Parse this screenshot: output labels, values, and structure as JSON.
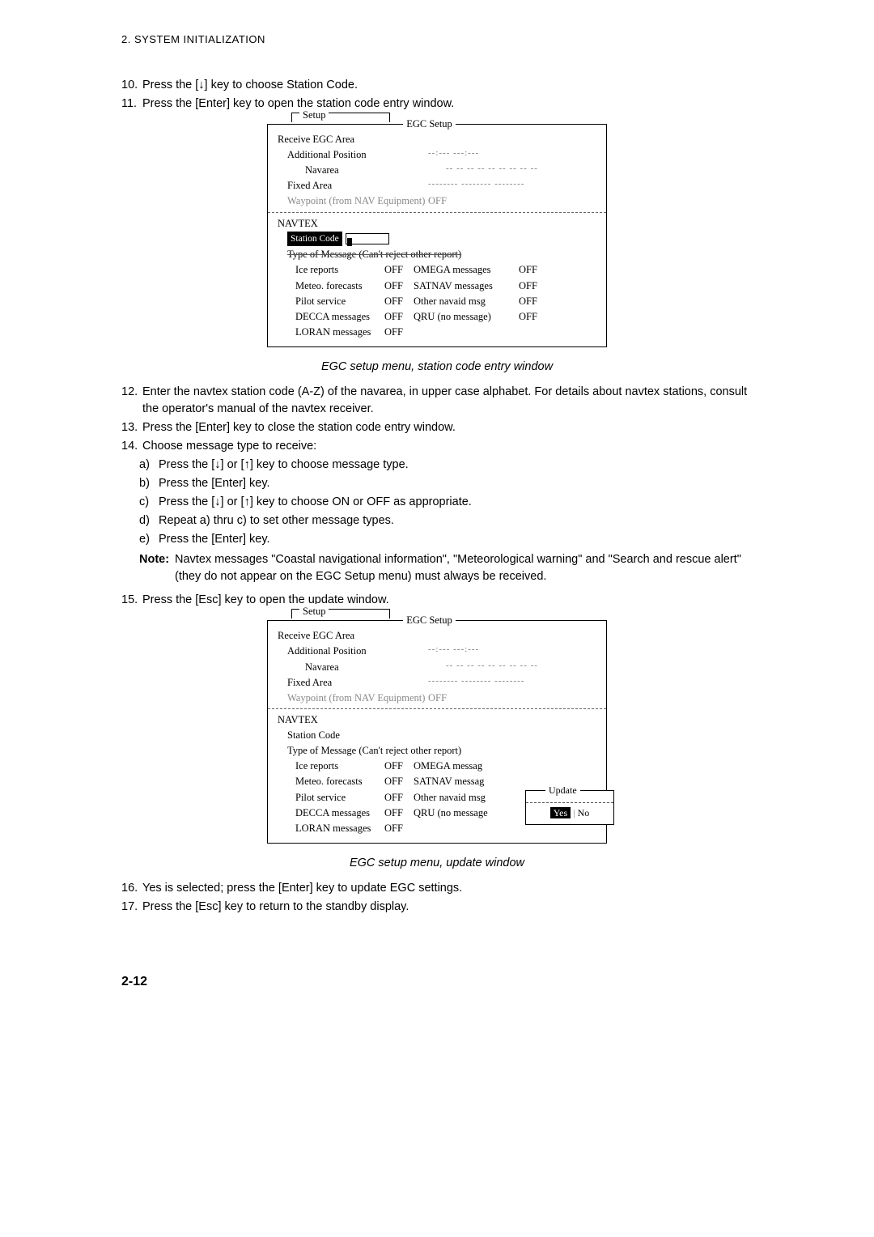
{
  "header": "2. SYSTEM INITIALIZATION",
  "steps": {
    "s10": "Press the [↓] key to choose Station Code.",
    "s11": "Press the [Enter] key to open the station code entry window.",
    "s12": "Enter the navtex station code (A-Z) of the navarea, in upper case alphabet. For details about navtex stations, consult the operator's manual of the navtex receiver.",
    "s13": "Press the [Enter] key to close the station code entry window.",
    "s14": "Choose message type to receive:",
    "s14a": "Press the [↓] or [↑] key to choose message type.",
    "s14b": "Press the [Enter] key.",
    "s14c": "Press the [↓] or [↑] key to choose ON or OFF as appropriate.",
    "s14d": "Repeat a) thru c) to set other message types.",
    "s14e": "Press the [Enter] key.",
    "noteLabel": "Note:",
    "noteText": "Navtex messages \"Coastal navigational information\", \"Meteorological warning\" and \"Search and rescue alert\" (they do not appear on the EGC Setup menu) must always be received.",
    "s15": "Press the [Esc] key to open the update window.",
    "s16": "Yes is selected; press the [Enter] key to update EGC settings.",
    "s17": "Press the [Esc] key to return to the standby display."
  },
  "fig": {
    "setup": "Setup",
    "egc": "EGC Setup",
    "r1": "Receive EGC Area",
    "r2": "Additional Position",
    "r2v": "--:---  ---:---",
    "r3": "Navarea",
    "r3v": "--  --  --  --  --  --  --  --  --",
    "r4": "Fixed Area",
    "r4v": "--------  --------  --------",
    "r5": "Waypoint (from NAV Equipment)",
    "off": "OFF",
    "navtex": "NAVTEX",
    "stationCode": "Station Code",
    "tomLine": "Type of Message (Can't reject other report)",
    "msgs": {
      "ice": "Ice reports",
      "meteo": "Meteo. forecasts",
      "pilot": "Pilot service",
      "decca": "DECCA messages",
      "loran": "LORAN messages",
      "omega": "OMEGA messages",
      "satnav": "SATNAV messages",
      "other": "Other navaid msg",
      "qru": "QRU (no message)",
      "omega_s": "OMEGA messag",
      "satnav_s": "SATNAV messag",
      "other_s": "Other navaid msg",
      "qru_s": "QRU (no message"
    },
    "update": "Update",
    "yes": "Yes",
    "no": "No"
  },
  "captions": {
    "c1": "EGC setup menu, station code entry window",
    "c2": "EGC setup menu, update window"
  },
  "pagefoot": "2-12"
}
